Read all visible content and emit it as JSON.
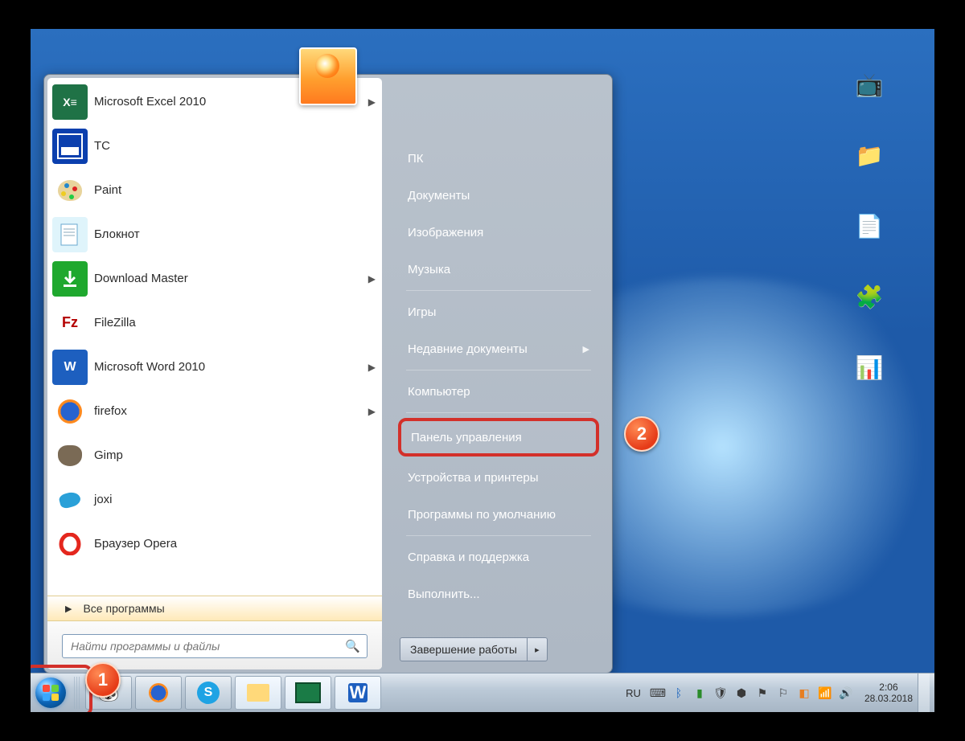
{
  "start_menu": {
    "programs": [
      {
        "label": "Microsoft Excel 2010",
        "icon": "excel-icon",
        "has_submenu": true
      },
      {
        "label": "TC",
        "icon": "tc-icon",
        "has_submenu": false
      },
      {
        "label": "Paint",
        "icon": "paint-icon",
        "has_submenu": false
      },
      {
        "label": "Блокнот",
        "icon": "notepad-icon",
        "has_submenu": false
      },
      {
        "label": "Download Master",
        "icon": "downloadmaster-icon",
        "has_submenu": true
      },
      {
        "label": "FileZilla",
        "icon": "filezilla-icon",
        "has_submenu": false
      },
      {
        "label": "Microsoft Word 2010",
        "icon": "word-icon",
        "has_submenu": true
      },
      {
        "label": "firefox",
        "icon": "firefox-icon",
        "has_submenu": true
      },
      {
        "label": "Gimp",
        "icon": "gimp-icon",
        "has_submenu": false
      },
      {
        "label": "joxi",
        "icon": "joxi-icon",
        "has_submenu": false
      },
      {
        "label": "Браузер Opera",
        "icon": "opera-icon",
        "has_submenu": false
      }
    ],
    "all_programs_label": "Все программы",
    "search_placeholder": "Найти программы и файлы",
    "right_items": [
      {
        "label": "ПК",
        "has_submenu": false
      },
      {
        "label": "Документы",
        "has_submenu": false
      },
      {
        "label": "Изображения",
        "has_submenu": false
      },
      {
        "label": "Музыка",
        "has_submenu": false
      },
      {
        "label": "Игры",
        "has_submenu": false
      },
      {
        "label": "Недавние документы",
        "has_submenu": true
      },
      {
        "label": "Компьютер",
        "has_submenu": false
      },
      {
        "label": "Панель управления",
        "has_submenu": false,
        "highlighted": true
      },
      {
        "label": "Устройства и принтеры",
        "has_submenu": false
      },
      {
        "label": "Программы по умолчанию",
        "has_submenu": false
      },
      {
        "label": "Справка и поддержка",
        "has_submenu": false
      },
      {
        "label": "Выполнить...",
        "has_submenu": false
      }
    ],
    "shutdown_label": "Завершение работы"
  },
  "taskbar": {
    "language": "RU",
    "time": "2:06",
    "date": "28.03.2018",
    "pinned": [
      {
        "name": "panda-icon"
      },
      {
        "name": "firefox-icon"
      },
      {
        "name": "skype-icon"
      },
      {
        "name": "explorer-icon"
      },
      {
        "name": "task-viewer-icon"
      },
      {
        "name": "word-icon"
      }
    ],
    "tray_icons": [
      "onedrive-icon",
      "bluetooth-icon",
      "app-icon",
      "antivirus-icon",
      "shield-icon",
      "update-icon",
      "flag-icon",
      "tool-icon",
      "network-icon",
      "volume-icon"
    ]
  },
  "annotations": {
    "badge1": "1",
    "badge2": "2"
  }
}
